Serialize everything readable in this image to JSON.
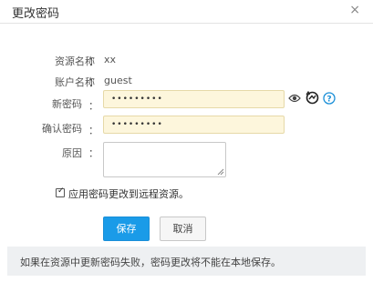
{
  "dialog": {
    "title": "更改密码",
    "close_glyph": "×"
  },
  "form": {
    "colon": "：",
    "resource_name": {
      "label": "资源名称",
      "value": "xx"
    },
    "account_name": {
      "label": "账户名称",
      "value": "guest"
    },
    "new_password": {
      "label": "新密码",
      "value": "•••••••••"
    },
    "confirm_password": {
      "label": "确认密码",
      "value": "•••••••••"
    },
    "reason": {
      "label": "原因",
      "value": ""
    },
    "apply_remote": {
      "label": "应用密码更改到远程资源。",
      "checked": true,
      "check_glyph": "✓"
    }
  },
  "icons": [
    "eye-icon",
    "password-generator-icon",
    "help-icon"
  ],
  "buttons": {
    "save": "保存",
    "cancel": "取消"
  },
  "notice": "如果在资源中更新密码失败，密码更改将不能在本地保存。",
  "colors": {
    "accent": "#1a9be8",
    "password_bg": "#fdf6dc",
    "notice_bg": "#eef0f2"
  }
}
